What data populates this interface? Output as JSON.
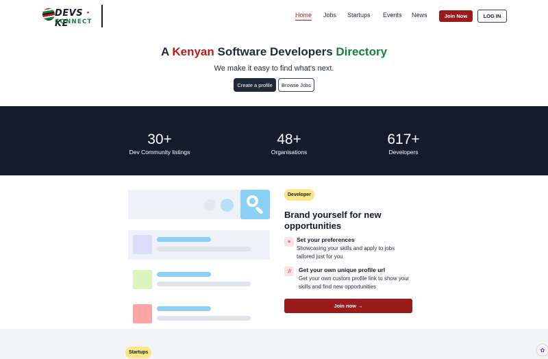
{
  "brand": {
    "logo_word1a": "DEVS",
    "logo_dot": "·",
    "logo_word1b": "KE",
    "logo_word2": "CONNECT"
  },
  "nav": {
    "items": [
      "Home",
      "Jobs",
      "Startups",
      "Events",
      "News"
    ],
    "active": "Home",
    "join_label": "Join Now",
    "login_label": "LOG IN"
  },
  "hero": {
    "title_part1": "A ",
    "title_highlight1": "Kenyan",
    "title_part2": " Software Developers ",
    "title_highlight2": "Directory",
    "subtitle": "We make it easy to find what's next.",
    "create_profile_label": "Create a profile",
    "browse_jobs_label": "Browse Jobs"
  },
  "stats": [
    {
      "value": "30+",
      "label": "Dev Community listings"
    },
    {
      "value": "48+",
      "label": "Organisations"
    },
    {
      "value": "617+",
      "label": "Developers"
    }
  ],
  "feature": {
    "badge": "Developer",
    "title": "Brand yourself for new opportunities",
    "items": [
      {
        "icon": "settings-icon",
        "icon_glyph": "≡",
        "heading": "Set your preferences",
        "desc": "Showcasing your skills and apply to jobs tailored just for you"
      },
      {
        "icon": "link-icon",
        "icon_glyph": "://",
        "heading": "Get your own unique profile url",
        "desc": "Get your own custom profile link to show your skills and find new opportunities"
      }
    ],
    "cta_label": "Join now →"
  },
  "next_section": {
    "badge": "Startups"
  },
  "colors": {
    "brand_red": "#991b1b",
    "brand_green": "#15803d",
    "dark_band": "#141c2c",
    "badge_yellow": "#fde68a"
  }
}
